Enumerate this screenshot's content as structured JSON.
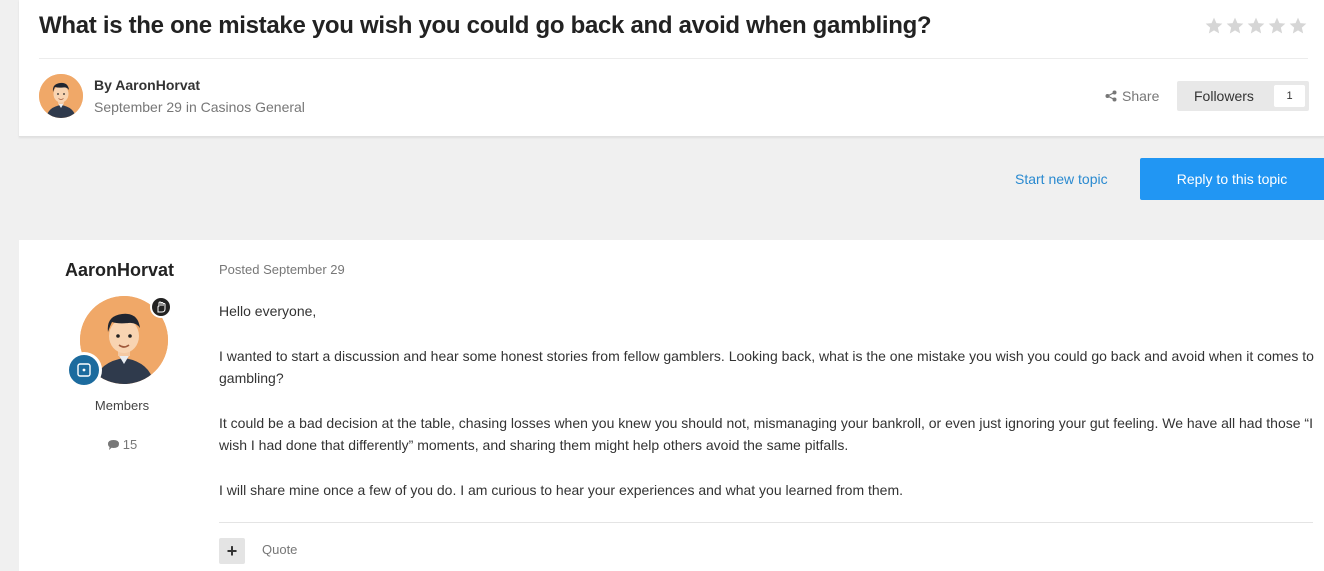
{
  "topic": {
    "title": "What is the one mistake you wish you could go back and avoid when gambling?",
    "rating_stars": 5,
    "by_prefix": "By",
    "author": "AaronHorvat",
    "date": "September 29",
    "in_word": "in",
    "forum": "Casinos General"
  },
  "actions": {
    "share_label": "Share",
    "followers_label": "Followers",
    "followers_count": "1",
    "start_new_topic": "Start new topic",
    "reply_to_topic": "Reply to this topic"
  },
  "post": {
    "author": "AaronHorvat",
    "group": "Members",
    "post_count": "15",
    "posted_date": "Posted September 29",
    "paragraphs": [
      "Hello everyone,",
      "I wanted to start a discussion and hear some honest stories from fellow gamblers. Looking back, what is the one mistake you wish you could go back and avoid when it comes to gambling?",
      "It could be a bad decision at the table, chasing losses when you knew you should not, mismanaging your bankroll, or even just ignoring your gut feeling. We have all had those “I wish I had done that differently” moments, and sharing them might help others avoid the same pitfalls.",
      "I will share mine once a few of you do. I am curious to hear your experiences and what you learned from them."
    ],
    "quote_label": "Quote",
    "multiquote_label": "+"
  },
  "colors": {
    "accent": "#2196f3",
    "link": "#2a8ad0",
    "star_empty": "#d6d6d6",
    "avatar_bg": "#f0a868",
    "group_badge": "#1c6b9e"
  }
}
